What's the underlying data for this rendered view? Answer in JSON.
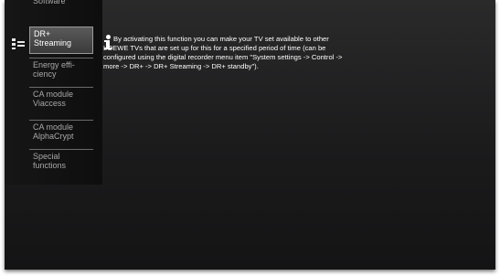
{
  "menu": {
    "items": [
      {
        "label": "Software",
        "selected": false
      },
      {
        "label": "DR+\nStreaming",
        "selected": true
      },
      {
        "label": "Energy effi-\nciency",
        "selected": false
      },
      {
        "label": "CA module\nViaccess",
        "selected": false
      },
      {
        "label": "CA module\nAlphaCrypt",
        "selected": false
      },
      {
        "label": "Special\nfunctions",
        "selected": false
      }
    ],
    "icon": "menu-settings-icon"
  },
  "info": {
    "icon": "info-icon",
    "text": "By activating this function you can make your TV set available to other LOEWE TVs that are set up for this for a specified period of time (can be configured using the digital recorder menu item \"System settings -> Control -> more -> DR+ -> DR+ Streaming -> DR+ standby\")."
  },
  "colors": {
    "screen_background": "#1b1b1c",
    "selected_item": "#4a4a4a",
    "text_primary": "#ffffff",
    "text_secondary": "#a8a8a8"
  }
}
